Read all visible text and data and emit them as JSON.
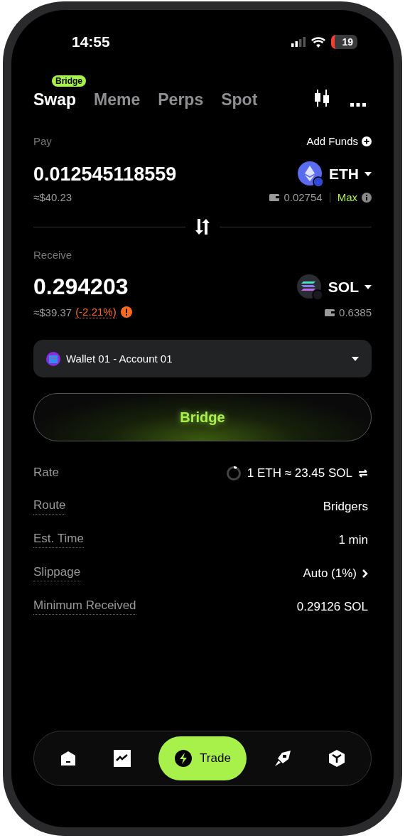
{
  "status_bar": {
    "time": "14:55",
    "battery": "19"
  },
  "tabs": [
    {
      "label": "Swap",
      "selected": true,
      "badge": "Bridge"
    },
    {
      "label": "Meme",
      "selected": false
    },
    {
      "label": "Perps",
      "selected": false
    },
    {
      "label": "Spot",
      "selected": false
    }
  ],
  "pay": {
    "label": "Pay",
    "add_funds": "Add Funds",
    "amount": "0.012545118559",
    "usd": "≈$40.23",
    "token": "ETH",
    "balance": "0.02754",
    "max": "Max"
  },
  "receive": {
    "label": "Receive",
    "amount": "0.294203",
    "usd": "≈$39.37",
    "change": "(-2.21%)",
    "token": "SOL",
    "balance": "0.6385"
  },
  "wallet": {
    "name": "Wallet 01 - Account 01"
  },
  "action_button": "Bridge",
  "details": [
    {
      "label": "Rate",
      "value": "1 ETH ≈ 23.45 SOL",
      "kind": "rate"
    },
    {
      "label": "Route",
      "value": "Bridgers",
      "kind": "plain"
    },
    {
      "label": "Est. Time",
      "value": "1 min",
      "kind": "plain"
    },
    {
      "label": "Slippage",
      "value": "Auto (1%)",
      "kind": "link"
    },
    {
      "label": "Minimum Received",
      "value": "0.29126 SOL",
      "kind": "plain"
    }
  ],
  "nav": [
    {
      "kind": "home",
      "selected": false
    },
    {
      "kind": "chart",
      "selected": false
    },
    {
      "kind": "trade",
      "label": "Trade",
      "selected": true
    },
    {
      "kind": "rocket",
      "selected": false
    },
    {
      "kind": "cube",
      "selected": false
    }
  ]
}
